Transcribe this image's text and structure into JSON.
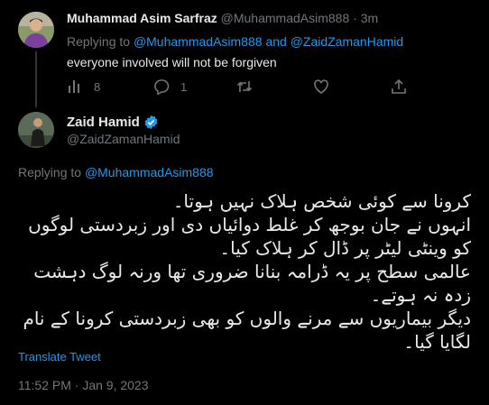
{
  "reply_tweet": {
    "display_name": "Muhammad Asim Sarfraz",
    "handle": "@MuhammadAsim888",
    "separator": "·",
    "time": "3m",
    "replying_prefix": "Replying to",
    "replying_user1": "@MuhammadAsim888",
    "replying_and": "and",
    "replying_user2": "@ZaidZamanHamid",
    "text": "everyone involved will not be forgiven",
    "views": "8",
    "replies": "1"
  },
  "main_tweet": {
    "display_name": "Zaid Hamid",
    "handle": "@ZaidZamanHamid",
    "replying_prefix": "Replying to",
    "replying_user": "@MuhammadAsim888",
    "lines": [
      "کرونا سے کوئی شخص ہلاک نہیں ہوتا۔",
      "انہوں نے جان بوجھ کر غلط دوائیاں دی اور زبردستی لوگوں کو وینٹی لیٹر پر ڈال کر ہلاک کیا۔",
      "عالمی سطح پر یہ ڈرامہ بنانا ضروری تھا ورنہ لوگ دہشت زدہ نہ ہوتے۔",
      "دیگر بیماریوں سے مرنے والوں کو بھی زبردستی کرونا کے نام لگایا گیا۔"
    ],
    "translate_label": "Translate Tweet",
    "timestamp": "11:52 PM · Jan 9, 2023"
  },
  "icons": {
    "views": "bar-chart-icon",
    "reply": "speech-bubble-icon",
    "retweet": "retweet-icon",
    "like": "heart-icon",
    "share": "share-icon",
    "verified": "verified-badge-icon"
  },
  "colors": {
    "background": "#000000",
    "text": "#e7e9ea",
    "muted": "#71767b",
    "link": "#1d9bf0"
  }
}
